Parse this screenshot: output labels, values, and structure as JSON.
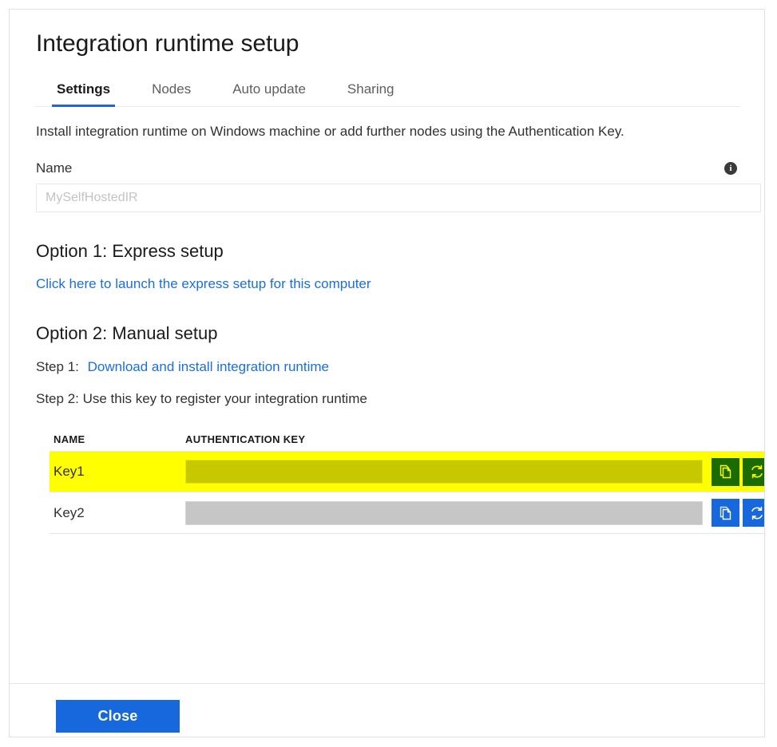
{
  "blade": {
    "title": "Integration runtime setup"
  },
  "tabs": [
    {
      "label": "Settings",
      "active": true
    },
    {
      "label": "Nodes",
      "active": false
    },
    {
      "label": "Auto update",
      "active": false
    },
    {
      "label": "Sharing",
      "active": false
    }
  ],
  "intro": "Install integration runtime on Windows machine or add further nodes using the Authentication Key.",
  "name_field": {
    "label": "Name",
    "value": "",
    "placeholder": "MySelfHostedIR",
    "info_icon": "info-icon",
    "info_glyph": "i"
  },
  "option1": {
    "heading": "Option 1: Express setup",
    "link": "Click here to launch the express setup for this computer"
  },
  "option2": {
    "heading": "Option 2: Manual setup",
    "step1_label": "Step 1:",
    "step1_link": "Download and install integration runtime",
    "step2_text": "Step 2: Use this key to register your integration runtime"
  },
  "key_table": {
    "columns": [
      "NAME",
      "AUTHENTICATION KEY"
    ],
    "rows": [
      {
        "name": "Key1",
        "key_value": "",
        "highlighted": true,
        "copy_icon": "copy-icon",
        "refresh_icon": "refresh-icon"
      },
      {
        "name": "Key2",
        "key_value": "",
        "highlighted": false,
        "copy_icon": "copy-icon",
        "refresh_icon": "refresh-icon"
      }
    ]
  },
  "footer": {
    "close_label": "Close"
  },
  "colors": {
    "accent_blue": "#1668dc",
    "link_blue": "#1a6fe0",
    "tab_underline": "#2563d9",
    "highlight_yellow": "#ffff00",
    "highlight_button_green": "#1a6b00",
    "key_field_gray": "#c6c6c6",
    "key_field_highlighted": "#c8c800"
  }
}
